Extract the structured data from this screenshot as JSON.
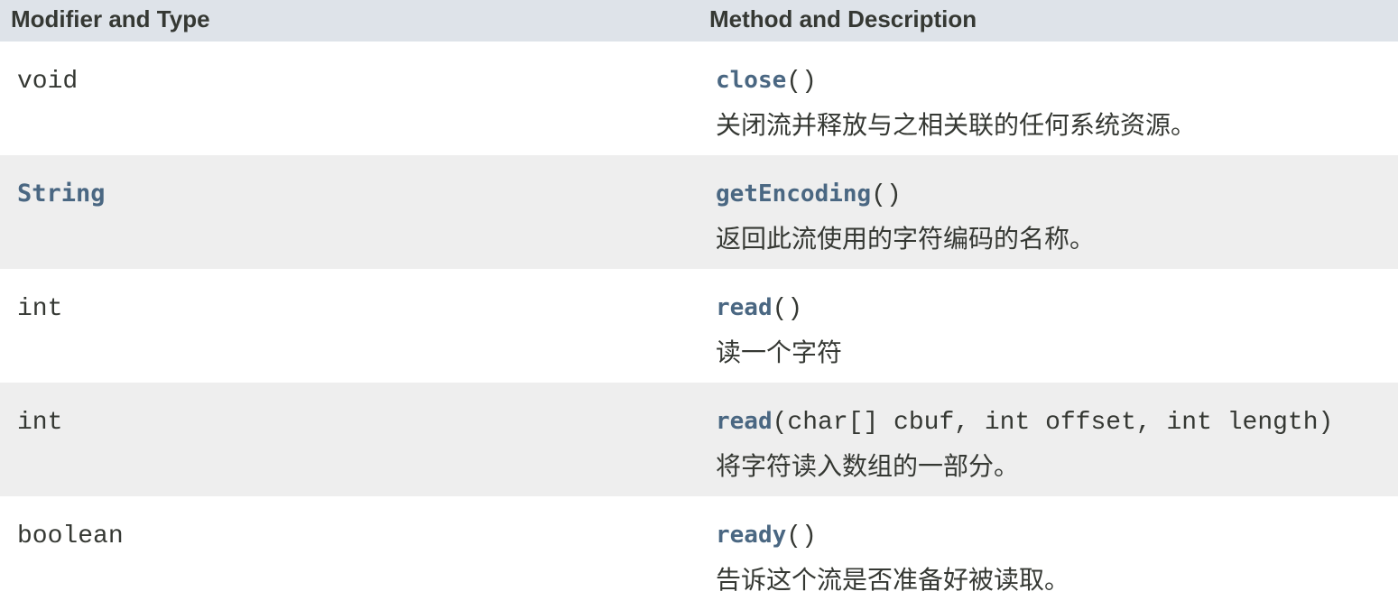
{
  "header": {
    "col1": "Modifier and Type",
    "col2": "Method and Description"
  },
  "rows": [
    {
      "type": "void",
      "type_is_link": false,
      "method_name": "close",
      "params": "()",
      "description": "关闭流并释放与之相关联的任何系统资源。"
    },
    {
      "type": "String",
      "type_is_link": true,
      "method_name": "getEncoding",
      "params": "()",
      "description": "返回此流使用的字符编码的名称。"
    },
    {
      "type": "int",
      "type_is_link": false,
      "method_name": "read",
      "params": "()",
      "description": "读一个字符"
    },
    {
      "type": "int",
      "type_is_link": false,
      "method_name": "read",
      "params": "(char[] cbuf, int offset, int length)",
      "description": "将字符读入数组的一部分。"
    },
    {
      "type": "boolean",
      "type_is_link": false,
      "method_name": "ready",
      "params": "()",
      "description": "告诉这个流是否准备好被读取。"
    }
  ],
  "colors": {
    "header_bg": "#dee3e9",
    "alt_row_bg": "#eeeeee",
    "link": "#4a6782",
    "text": "#353833"
  }
}
